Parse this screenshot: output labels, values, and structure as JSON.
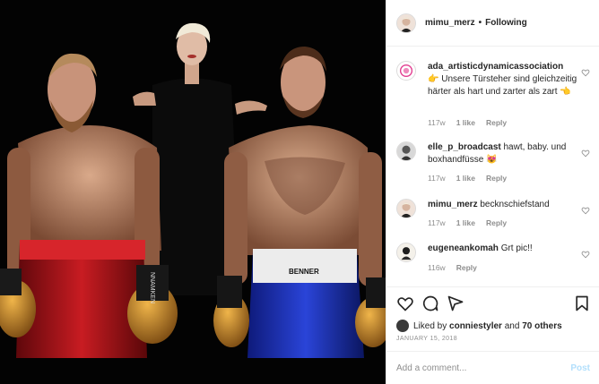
{
  "post": {
    "username": "mimu_merz",
    "separator": "•",
    "follow_status": "Following"
  },
  "comments": [
    {
      "username": "ada_artisticdynamicassociation",
      "text": "👉 Unsere Türsteher sind gleichzeitig härter als hart und zarter als zart 👈",
      "age": "117w",
      "likes": "1 like",
      "reply": "Reply",
      "avatar": "ada-logo-avatar"
    },
    {
      "username": "elle_p_broadcast",
      "text": "hawt, baby. und boxhandfüsse 😻",
      "age": "117w",
      "likes": "1 like",
      "reply": "Reply",
      "avatar": "elle-avatar"
    },
    {
      "username": "mimu_merz",
      "text": "becknschiefstand",
      "age": "117w",
      "likes": "1 like",
      "reply": "Reply",
      "avatar": "mimu-avatar"
    },
    {
      "username": "eugeneankomah",
      "text": "Grt pic!!",
      "age": "116w",
      "likes": "",
      "reply": "Reply",
      "avatar": "eugene-avatar"
    }
  ],
  "likes": {
    "prefix": "Liked by",
    "user": "conniestyler",
    "and": "and",
    "count": "70 others"
  },
  "date": "JANUARY 15, 2018",
  "add_comment": {
    "placeholder": "Add a comment...",
    "post_label": "Post"
  },
  "photo": {
    "left_trunks_text": "",
    "right_trunks_text": "BENNER",
    "glove_text": "NNAMKEN"
  },
  "colors": {
    "accent_post": "#b2dffc",
    "muted": "#8e8e8e",
    "left_trunks": "#b0141a",
    "right_trunks": "#1a2fb8",
    "gloves": "#c98a2a"
  }
}
